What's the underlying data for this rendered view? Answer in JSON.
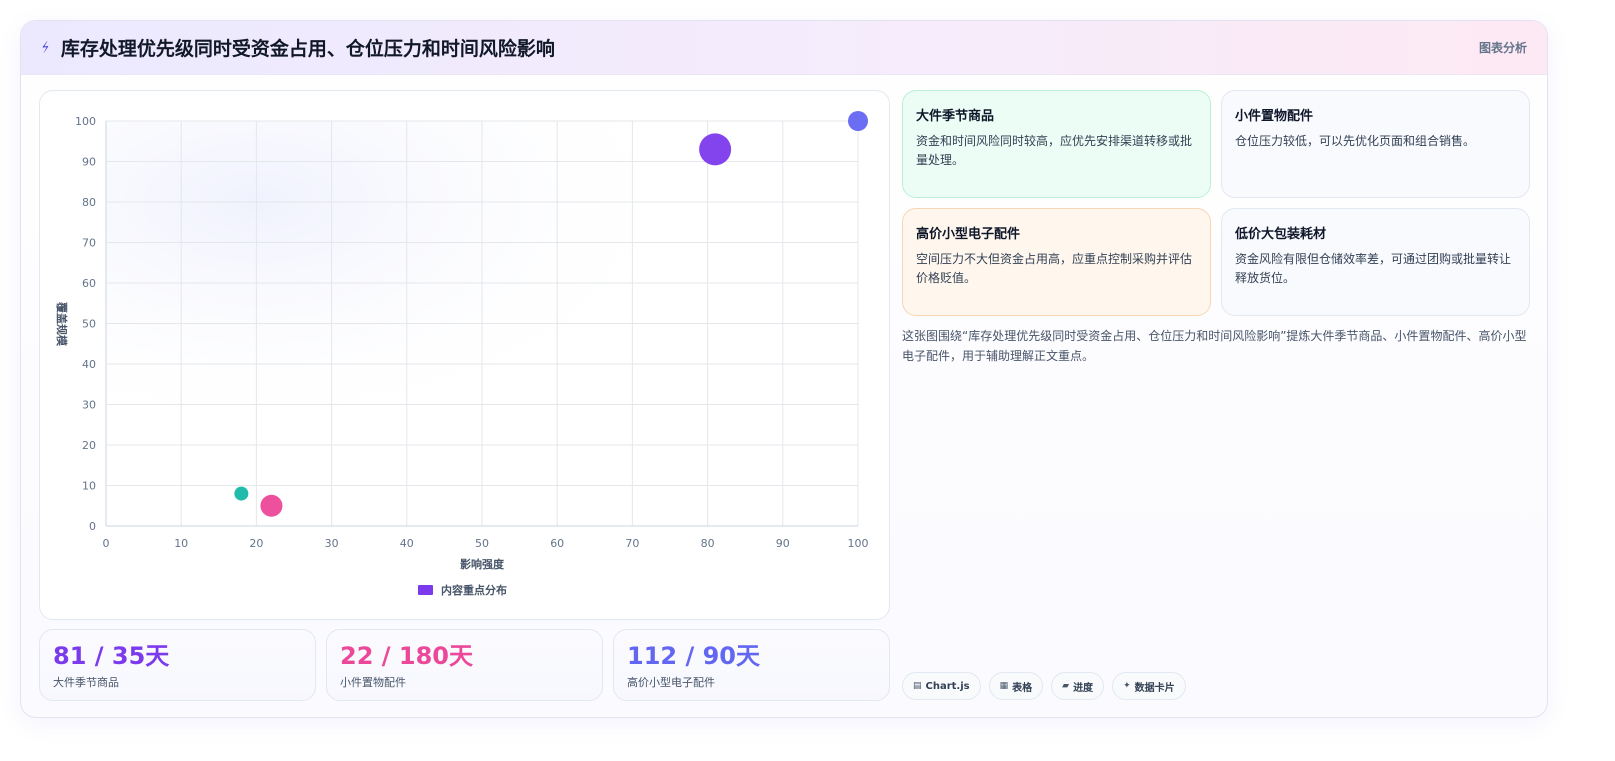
{
  "header": {
    "title": "库存处理优先级同时受资金占用、仓位压力和时间风险影响",
    "tag": "图表分析",
    "icon": "lightning-icon"
  },
  "colors": {
    "purple": "#7c3aed",
    "pink": "#ec4899",
    "indigo": "#6366f1",
    "teal": "#14b8a6"
  },
  "chart_data": {
    "type": "scatter",
    "xlabel": "影响强度",
    "ylabel": "覆盖规模",
    "xlim": [
      0,
      100
    ],
    "ylim": [
      0,
      100
    ],
    "x_ticks": [
      0,
      10,
      20,
      30,
      40,
      50,
      60,
      70,
      80,
      90,
      100
    ],
    "y_ticks": [
      0,
      10,
      20,
      30,
      40,
      50,
      60,
      70,
      80,
      90,
      100
    ],
    "grid": true,
    "legend_position": "bottom",
    "series": [
      {
        "name": "内容重点分布",
        "color": "#7c3aed",
        "points": [
          {
            "x": 81,
            "y": 93,
            "r": 16,
            "color": "#7c3aed"
          },
          {
            "x": 22,
            "y": 5,
            "r": 11,
            "color": "#ec4899"
          },
          {
            "x": 100,
            "y": 100,
            "r": 10,
            "color": "#6366f1"
          },
          {
            "x": 18,
            "y": 8,
            "r": 7,
            "color": "#14b8a6"
          }
        ]
      }
    ]
  },
  "stats": [
    {
      "value": "81 / 35天",
      "label": "大件季节商品",
      "color": "#7c3aed"
    },
    {
      "value": "22 / 180天",
      "label": "小件置物配件",
      "color": "#ec4899"
    },
    {
      "value": "112 / 90天",
      "label": "高价小型电子配件",
      "color": "#6366f1"
    }
  ],
  "cards": [
    {
      "title": "大件季节商品",
      "text": "资金和时间风险同时较高，应优先安排渠道转移或批量处理。"
    },
    {
      "title": "小件置物配件",
      "text": "仓位压力较低，可以先优化页面和组合销售。"
    },
    {
      "title": "高价小型电子配件",
      "text": "空间压力不大但资金占用高，应重点控制采购并评估价格贬值。"
    },
    {
      "title": "低价大包装耗材",
      "text": "资金风险有限但仓储效率差，可通过团购或批量转让释放货位。"
    }
  ],
  "summary": "这张图围绕“库存处理优先级同时受资金占用、仓位压力和时间风险影响”提炼大件季节商品、小件置物配件、高价小型电子配件，用于辅助理解正文重点。",
  "chips": [
    {
      "icon": "chart-icon",
      "glyph": "▤",
      "label": "Chart.js"
    },
    {
      "icon": "table-icon",
      "glyph": "▦",
      "label": "表格"
    },
    {
      "icon": "progress-icon",
      "glyph": "▰",
      "label": "进度"
    },
    {
      "icon": "sparkle-icon",
      "glyph": "✦",
      "label": "数据卡片"
    }
  ]
}
